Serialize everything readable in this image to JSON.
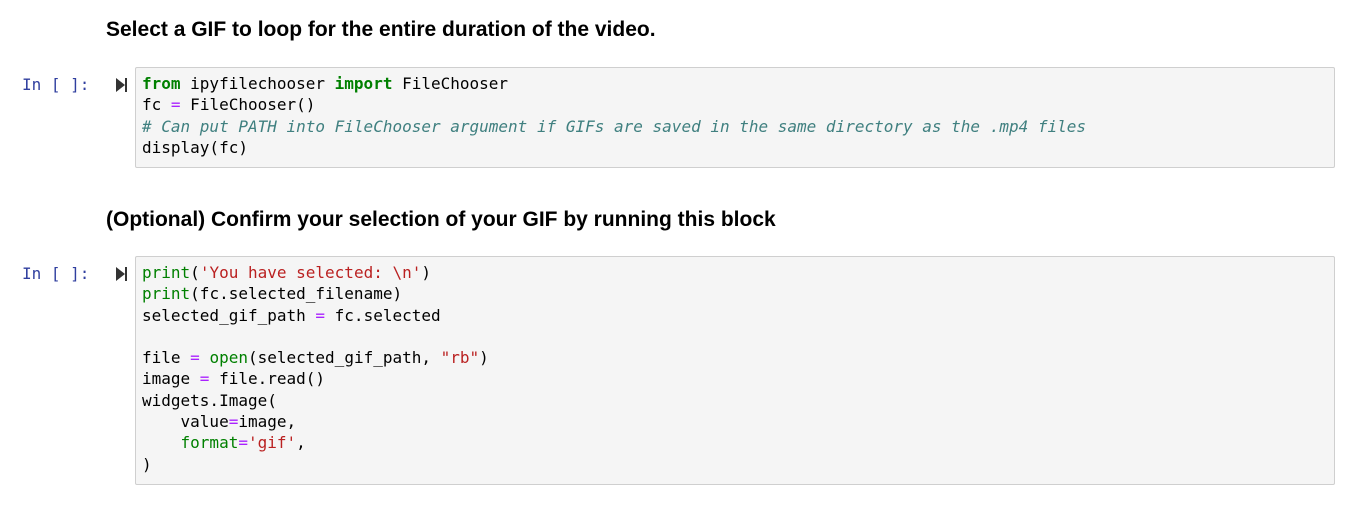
{
  "cells": [
    {
      "heading": "Select a GIF to loop for the entire duration of the video.",
      "prompt": "In [ ]:",
      "lines": [
        [
          {
            "t": "from",
            "c": "kw"
          },
          {
            "t": " ipyfilechooser ",
            "c": "plain"
          },
          {
            "t": "import",
            "c": "kw"
          },
          {
            "t": " FileChooser",
            "c": "plain"
          }
        ],
        [
          {
            "t": "fc ",
            "c": "plain"
          },
          {
            "t": "=",
            "c": "op"
          },
          {
            "t": " FileChooser()",
            "c": "plain"
          }
        ],
        [
          {
            "t": "# Can put PATH into FileChooser argument if GIFs are saved in the same directory as the .mp4 files",
            "c": "cm"
          }
        ],
        [
          {
            "t": "display(fc)",
            "c": "plain"
          }
        ]
      ]
    },
    {
      "heading": "(Optional) Confirm your selection of your GIF by running this block",
      "prompt": "In [ ]:",
      "lines": [
        [
          {
            "t": "print",
            "c": "bi"
          },
          {
            "t": "(",
            "c": "plain"
          },
          {
            "t": "'You have selected: \\n'",
            "c": "str"
          },
          {
            "t": ")",
            "c": "plain"
          }
        ],
        [
          {
            "t": "print",
            "c": "bi"
          },
          {
            "t": "(fc.selected_filename)",
            "c": "plain"
          }
        ],
        [
          {
            "t": "selected_gif_path ",
            "c": "plain"
          },
          {
            "t": "=",
            "c": "op"
          },
          {
            "t": " fc.selected",
            "c": "plain"
          }
        ],
        [],
        [
          {
            "t": "file ",
            "c": "plain"
          },
          {
            "t": "=",
            "c": "op"
          },
          {
            "t": " ",
            "c": "plain"
          },
          {
            "t": "open",
            "c": "bi"
          },
          {
            "t": "(selected_gif_path, ",
            "c": "plain"
          },
          {
            "t": "\"rb\"",
            "c": "str"
          },
          {
            "t": ")",
            "c": "plain"
          }
        ],
        [
          {
            "t": "image ",
            "c": "plain"
          },
          {
            "t": "=",
            "c": "op"
          },
          {
            "t": " file.read()",
            "c": "plain"
          }
        ],
        [
          {
            "t": "widgets.Image(",
            "c": "plain"
          }
        ],
        [
          {
            "t": "    value",
            "c": "plain"
          },
          {
            "t": "=",
            "c": "op"
          },
          {
            "t": "image,",
            "c": "plain"
          }
        ],
        [
          {
            "t": "    format",
            "c": "bi"
          },
          {
            "t": "=",
            "c": "op"
          },
          {
            "t": "'gif'",
            "c": "str"
          },
          {
            "t": ",",
            "c": "plain"
          }
        ],
        [
          {
            "t": ")",
            "c": "plain"
          }
        ]
      ]
    }
  ],
  "icons": {
    "run": "run-cell-icon"
  }
}
